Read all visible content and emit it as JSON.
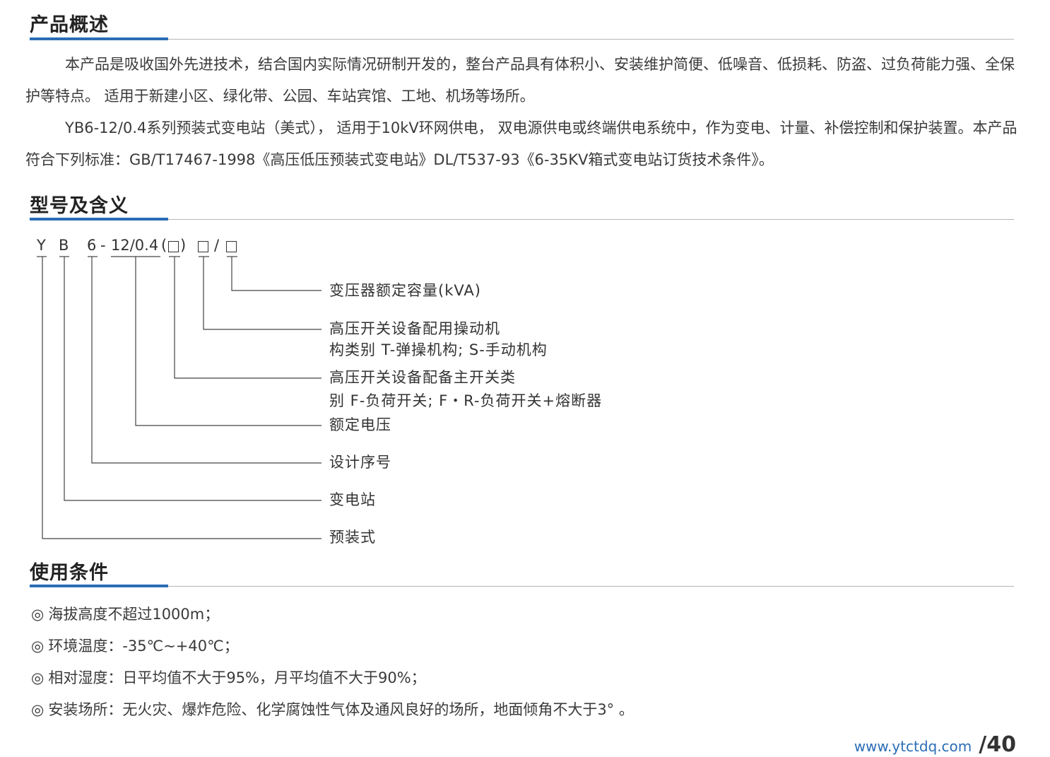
{
  "sections": {
    "overview": {
      "title": "产品概述",
      "p1": "本产品是吸收国外先进技术，结合国内实际情况研制开发的，整台产品具有体积小、安装维护简便、低噪音、低损耗、防盗、过负荷能力强、全保护等特点。 适用于新建小区、绿化带、公园、车站宾馆、工地、机场等场所。",
      "p2": "YB6-12/0.4系列预装式变电站（美式）， 适用于10kV环网供电， 双电源供电或终端供电系统中，作为变电、计量、补偿控制和保护装置。本产品符合下列标准：GB/T17467-1998《高压低压预装式变电站》DL/T537-93《6-35KV箱式变电站订货技术条件》。"
    },
    "model": {
      "title": "型号及含义",
      "code": {
        "y": "Y",
        "b": "B",
        "six": "6",
        "dash": "-",
        "rated": "12/0.4",
        "paren_open": "(",
        "paren_close": ")",
        "slash": "/"
      },
      "meanings": [
        "变压器额定容量(kVA)",
        "高压开关设备配用操动机",
        "构类别 T-弹操机构; S-手动机构",
        "高压开关设备配备主开关类",
        "别 F-负荷开关; F・R-负荷开关+熔断器",
        "额定电压",
        "设计序号",
        "变电站",
        "预装式"
      ]
    },
    "conditions": {
      "title": "使用条件",
      "bullet": "◎",
      "items": [
        "海拔高度不超过1000m；",
        "环境温度：-35℃~+40℃；",
        "相对湿度：日平均值不大于95%，月平均值不大于90%；",
        "安装场所：无火灾、爆炸危险、化学腐蚀性气体及通风良好的场所，地面倾角不大于3° 。"
      ]
    }
  },
  "footer": {
    "url": "www.ytctdq.com",
    "page": "/40"
  },
  "colors": {
    "accent": "#2a6db5",
    "text": "#333333",
    "rule": "#b5b5b5"
  }
}
